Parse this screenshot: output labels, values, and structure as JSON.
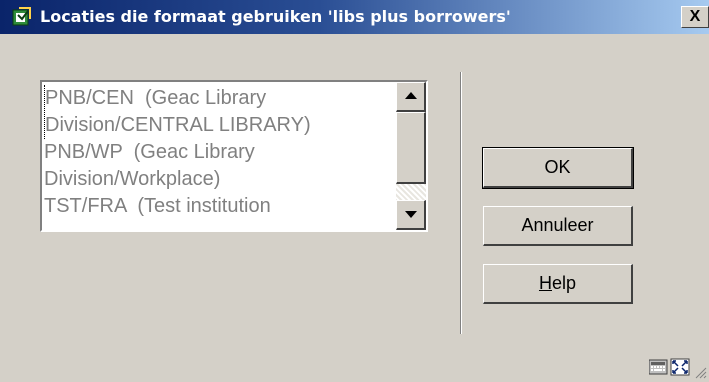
{
  "window": {
    "title": "Locaties die formaat gebruiken 'libs plus borrowers'",
    "close_label": "X"
  },
  "list": {
    "items": [
      "PNB/CEN  (Geac Library\nDivision/CENTRAL LIBRARY)",
      "PNB/WP  (Geac Library\nDivision/Workplace)",
      "TST/FRA  (Test institution"
    ]
  },
  "buttons": {
    "ok": "OK",
    "cancel": "Annuleer",
    "help_prefix": "H",
    "help_rest": "elp"
  },
  "icons": {
    "title": "app-window-icon",
    "keyboard": "keyboard-icon",
    "fullscreen": "fullscreen-icon",
    "resize": "resize-grip-icon"
  }
}
